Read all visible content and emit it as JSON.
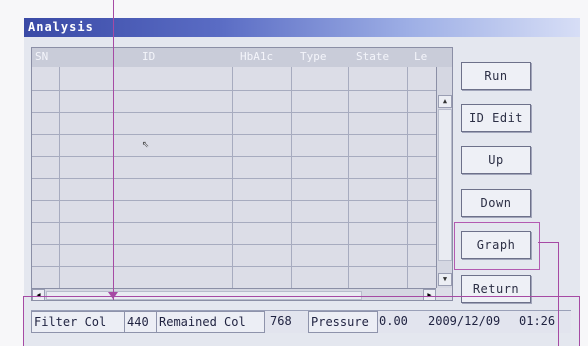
{
  "window": {
    "title": "Analysis"
  },
  "table": {
    "columns": [
      "SN",
      "ID",
      "HbA1c",
      "Type",
      "State",
      "Le"
    ],
    "rows": 10
  },
  "buttons": {
    "run": "Run",
    "id_edit": "ID Edit",
    "up": "Up",
    "down": "Down",
    "graph": "Graph",
    "return": "Return"
  },
  "status": {
    "filter_col_label": "Filter Col",
    "filter_col_value": "440",
    "remained_col_label": "Remained Col",
    "remained_col_value": "768",
    "pressure_label": "Pressure",
    "pressure_value": "0.00",
    "date": "2009/12/09",
    "time": "01:26"
  },
  "icons": {
    "scroll_up": "triangle-up",
    "scroll_down": "triangle-down",
    "scroll_left": "triangle-left",
    "scroll_right": "triangle-right",
    "mouse_pointer": "arrow-cursor"
  },
  "colors": {
    "titlebar_start": "#3a4aa6",
    "annotation_line": "#a64aa4"
  }
}
